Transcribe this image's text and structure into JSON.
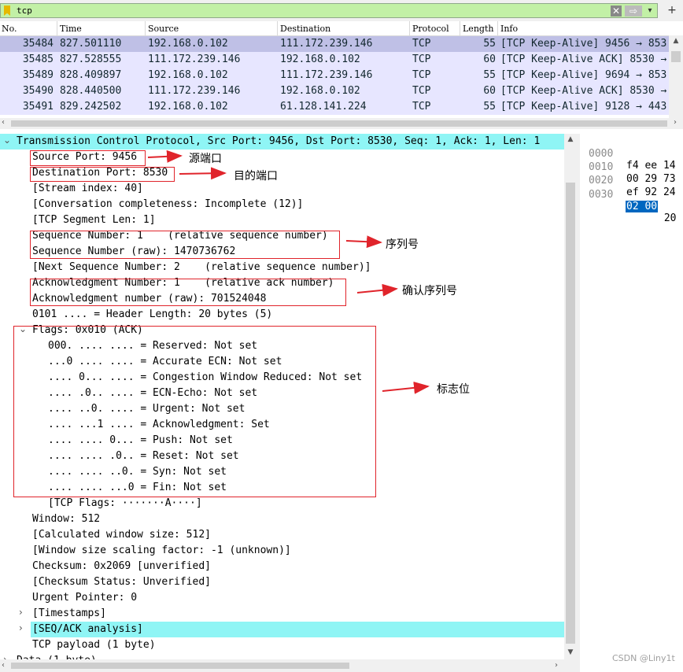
{
  "filter": {
    "value": "tcp",
    "clear_icon": "close-icon",
    "apply_icon": "arrow-right-icon",
    "dropdown_icon": "chevron-down-icon",
    "add_icon": "plus-icon"
  },
  "packet_list": {
    "columns": [
      "No.",
      "Time",
      "Source",
      "Destination",
      "Protocol",
      "Length",
      "Info"
    ],
    "rows": [
      {
        "no": "35484",
        "time": "827.501110",
        "src": "192.168.0.102",
        "dst": "111.172.239.146",
        "proto": "TCP",
        "len": "55",
        "info": "[TCP Keep-Alive] 9456 → 853"
      },
      {
        "no": "35485",
        "time": "827.528555",
        "src": "111.172.239.146",
        "dst": "192.168.0.102",
        "proto": "TCP",
        "len": "60",
        "info": "[TCP Keep-Alive ACK] 8530 →"
      },
      {
        "no": "35489",
        "time": "828.409897",
        "src": "192.168.0.102",
        "dst": "111.172.239.146",
        "proto": "TCP",
        "len": "55",
        "info": "[TCP Keep-Alive] 9694 → 853"
      },
      {
        "no": "35490",
        "time": "828.440500",
        "src": "111.172.239.146",
        "dst": "192.168.0.102",
        "proto": "TCP",
        "len": "60",
        "info": "[TCP Keep-Alive ACK] 8530 →"
      },
      {
        "no": "35491",
        "time": "829.242502",
        "src": "192.168.0.102",
        "dst": "61.128.141.224",
        "proto": "TCP",
        "len": "55",
        "info": "[TCP Keep-Alive] 9128 → 443"
      }
    ]
  },
  "details": {
    "lines": [
      "Transmission Control Protocol, Src Port: 9456, Dst Port: 8530, Seq: 1, Ack: 1, Len: 1",
      "Source Port: 9456",
      "Destination Port: 8530",
      "[Stream index: 40]",
      "[Conversation completeness: Incomplete (12)]",
      "[TCP Segment Len: 1]",
      "Sequence Number: 1    (relative sequence number)",
      "Sequence Number (raw): 1470736762",
      "[Next Sequence Number: 2    (relative sequence number)]",
      "Acknowledgment Number: 1    (relative ack number)",
      "Acknowledgment number (raw): 701524048",
      "0101 .... = Header Length: 20 bytes (5)",
      "Flags: 0x010 (ACK)",
      "000. .... .... = Reserved: Not set",
      "...0 .... .... = Accurate ECN: Not set",
      ".... 0... .... = Congestion Window Reduced: Not set",
      ".... .0.. .... = ECN-Echo: Not set",
      ".... ..0. .... = Urgent: Not set",
      ".... ...1 .... = Acknowledgment: Set",
      ".... .... 0... = Push: Not set",
      ".... .... .0.. = Reset: Not set",
      ".... .... ..0. = Syn: Not set",
      ".... .... ...0 = Fin: Not set",
      "[TCP Flags: ·······A····]",
      "Window: 512",
      "[Calculated window size: 512]",
      "[Window size scaling factor: -1 (unknown)]",
      "Checksum: 0x2069 [unverified]",
      "[Checksum Status: Unverified]",
      "Urgent Pointer: 0",
      "[Timestamps]",
      "[SEQ/ACK analysis]",
      "TCP payload (1 byte)",
      "Data (1 byte)"
    ]
  },
  "bytes": {
    "rows": [
      {
        "offset": "0000",
        "hex": "f4 ee 14"
      },
      {
        "offset": "0010",
        "hex": "00 29 73"
      },
      {
        "offset": "0020",
        "hex": "ef 92 24"
      },
      {
        "offset": "0030",
        "hex_selected": "02 00",
        "hex_rest": " 20"
      }
    ]
  },
  "annotations": {
    "src_port": "源端口",
    "dst_port": "目的端口",
    "seq": "序列号",
    "ack": "确认序列号",
    "flags": "标志位"
  },
  "watermark": "CSDN @Liny1t",
  "colors": {
    "filter_bg": "#c2f0a6",
    "row_selected": "#bfc0e6",
    "row_tcp": "#e7e6ff",
    "highlight": "#8ff5f5",
    "annot_red": "#e0242b",
    "byte_sel": "#0067c0"
  }
}
